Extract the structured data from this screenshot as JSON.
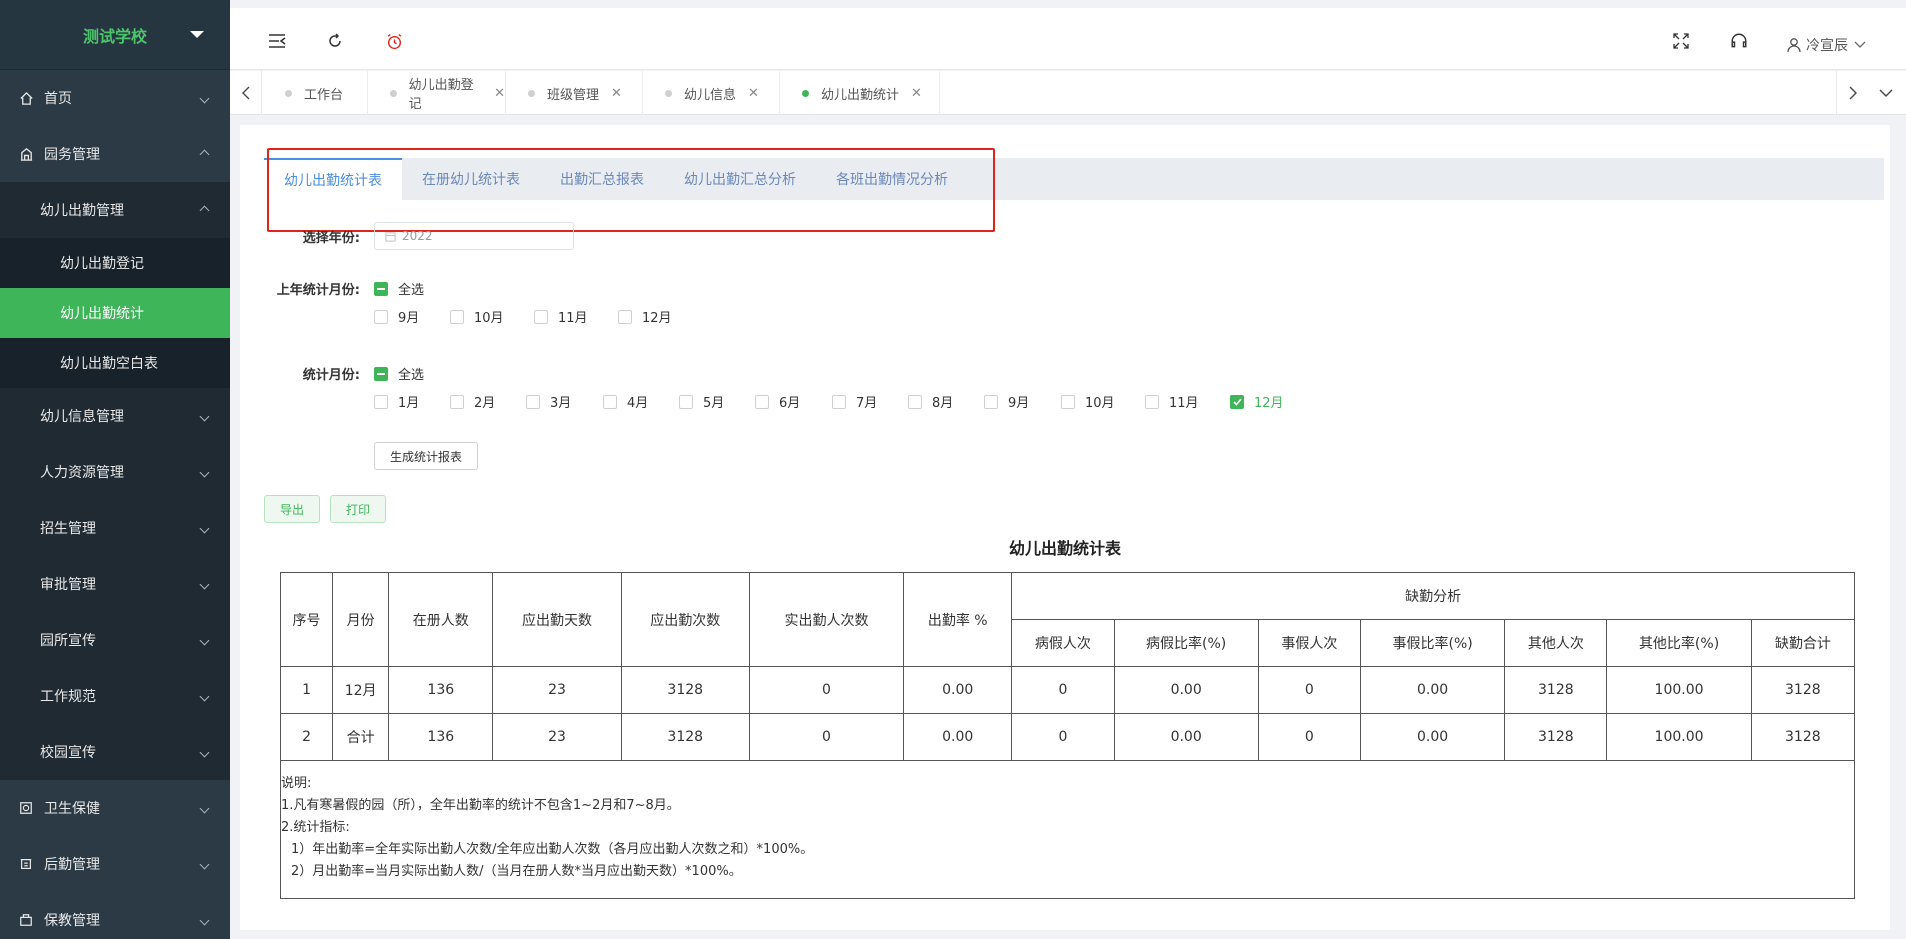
{
  "sidebar": {
    "brand": "测试学校",
    "items": [
      {
        "label": "首页",
        "icon": "home-icon"
      },
      {
        "label": "园务管理",
        "icon": "building-icon"
      },
      {
        "label": "幼儿出勤管理"
      },
      {
        "label": "幼儿出勤登记"
      },
      {
        "label": "幼儿出勤统计"
      },
      {
        "label": "幼儿出勤空白表"
      },
      {
        "label": "幼儿信息管理"
      },
      {
        "label": "人力资源管理"
      },
      {
        "label": "招生管理"
      },
      {
        "label": "审批管理"
      },
      {
        "label": "园所宣传"
      },
      {
        "label": "工作规范"
      },
      {
        "label": "校园宣传"
      },
      {
        "label": "卫生保健",
        "icon": "health-icon"
      },
      {
        "label": "后勤管理",
        "icon": "logistics-icon"
      },
      {
        "label": "保教管理",
        "icon": "education-icon"
      }
    ]
  },
  "topbar": {
    "user": "冷宣辰"
  },
  "page_tabs": [
    {
      "label": "工作台",
      "closable": false,
      "active": false
    },
    {
      "label": "幼儿出勤登记",
      "closable": true,
      "active": false
    },
    {
      "label": "班级管理",
      "closable": true,
      "active": false
    },
    {
      "label": "幼儿信息",
      "closable": true,
      "active": false
    },
    {
      "label": "幼儿出勤统计",
      "closable": true,
      "active": true
    }
  ],
  "subtabs": [
    "幼儿出勤统计表",
    "在册幼儿统计表",
    "出勤汇总报表",
    "幼儿出勤汇总分析",
    "各班出勤情况分析"
  ],
  "form": {
    "year_label": "选择年份:",
    "year_value": "2022",
    "prev_year_label": "上年统计月份:",
    "select_all": "全选",
    "prev_months": [
      "9月",
      "10月",
      "11月",
      "12月"
    ],
    "month_label": "统计月份:",
    "months": [
      "1月",
      "2月",
      "3月",
      "4月",
      "5月",
      "6月",
      "7月",
      "8月",
      "9月",
      "10月",
      "11月",
      "12月"
    ],
    "checked_month": "12月",
    "generate_button": "生成统计报表",
    "export_button": "导出",
    "print_button": "打印"
  },
  "report": {
    "title": "幼儿出勤统计表",
    "headers": {
      "seq": "序号",
      "month": "月份",
      "enrolled": "在册人数",
      "due_days": "应出勤天数",
      "due_count": "应出勤次数",
      "actual": "实出勤人次数",
      "rate": "出勤率 %",
      "absence_group": "缺勤分析",
      "sick": "病假人次",
      "sick_rate": "病假比率(%)",
      "personal": "事假人次",
      "personal_rate": "事假比率(%)",
      "other": "其他人次",
      "other_rate": "其他比率(%)",
      "total": "缺勤合计"
    },
    "rows": [
      [
        "1",
        "12月",
        "136",
        "23",
        "3128",
        "0",
        "0.00",
        "0",
        "0.00",
        "0",
        "0.00",
        "3128",
        "100.00",
        "3128"
      ],
      [
        "2",
        "合计",
        "136",
        "23",
        "3128",
        "0",
        "0.00",
        "0",
        "0.00",
        "0",
        "0.00",
        "3128",
        "100.00",
        "3128"
      ]
    ],
    "notes": [
      "说明:",
      "1.凡有寒暑假的园（所），全年出勤率的统计不包含1~2月和7~8月。",
      "2.统计指标:",
      "  1）年出勤率=全年实际出勤人次数/全年应出勤人次数（各月应出勤人次数之和）*100%。",
      "  2）月出勤率=当月实际出勤人数/（当月在册人数*当月应出勤天数）*100%。"
    ]
  }
}
